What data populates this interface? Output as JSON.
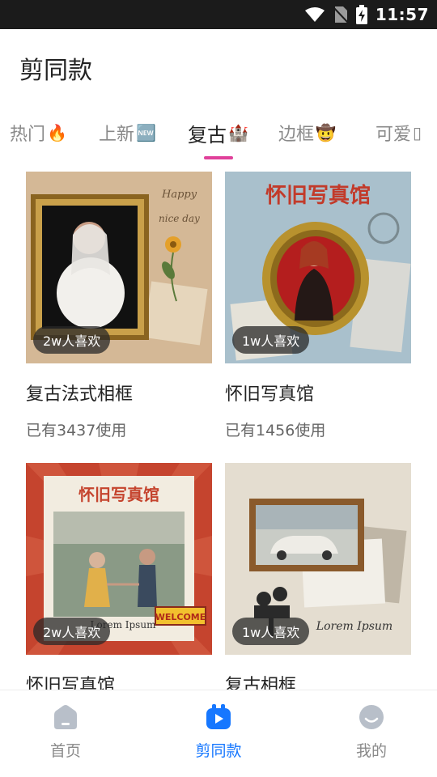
{
  "status_bar": {
    "time": "11:57"
  },
  "header": {
    "title": "剪同款"
  },
  "tabs": [
    {
      "label": "热门",
      "emoji": "🔥"
    },
    {
      "label": "上新",
      "emoji": "🆕"
    },
    {
      "label": "复古",
      "emoji": "🏰"
    },
    {
      "label": "边框",
      "emoji": "🤠"
    },
    {
      "label": "可爱",
      "emoji": "▯"
    }
  ],
  "templates": [
    {
      "title": "复古法式相框",
      "usage": "已有3437使用",
      "likes": "2w人喜欢",
      "thumb_texts": [
        "Happy",
        "nice day"
      ]
    },
    {
      "title": "怀旧写真馆",
      "usage": "已有1456使用",
      "likes": "1w人喜欢",
      "thumb_texts": [
        "怀旧写真馆"
      ]
    },
    {
      "title": "怀旧写真馆",
      "likes": "2w人喜欢",
      "thumb_texts": [
        "怀旧写真馆",
        "WELCOME",
        "Lorem Ipsum"
      ]
    },
    {
      "title": "复古相框",
      "likes": "1w人喜欢",
      "thumb_texts": [
        "Lorem Ipsum"
      ]
    }
  ],
  "bottom_nav": [
    {
      "label": "首页",
      "icon": "home-icon"
    },
    {
      "label": "剪同款",
      "icon": "play-template-icon"
    },
    {
      "label": "我的",
      "icon": "profile-icon"
    }
  ],
  "colors": {
    "accent_pink": "#e0409a",
    "nav_active": "#1677ff"
  }
}
